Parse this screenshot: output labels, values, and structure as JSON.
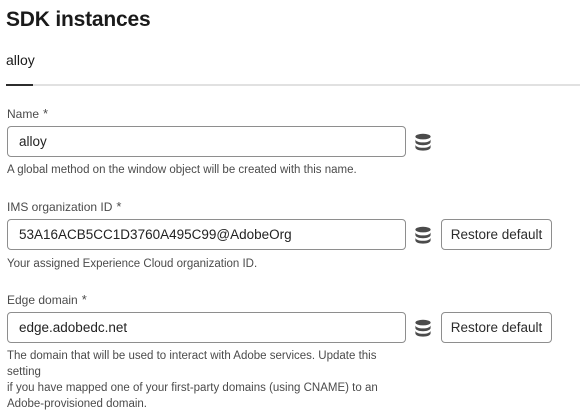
{
  "page": {
    "title": "SDK instances"
  },
  "tabs": [
    {
      "label": "alloy",
      "active": true
    }
  ],
  "fields": {
    "name": {
      "label": "Name",
      "required_marker": "*",
      "value": "alloy",
      "help": "A global method on the window object will be created with this name.",
      "icon": "database-icon"
    },
    "ims_org_id": {
      "label": "IMS organization ID",
      "required_marker": "*",
      "value": "53A16ACB5CC1D3760A495C99@AdobeOrg",
      "help": "Your assigned Experience Cloud organization ID.",
      "icon": "database-icon",
      "restore_label": "Restore default"
    },
    "edge_domain": {
      "label": "Edge domain",
      "required_marker": "*",
      "value": "edge.adobedc.net",
      "help_lines": [
        "The domain that will be used to interact with Adobe services. Update this setting",
        "if you have mapped one of your first-party domains (using CNAME) to an",
        "Adobe-provisioned domain."
      ],
      "icon": "database-icon",
      "restore_label": "Restore default"
    }
  },
  "colors": {
    "border": "#8e8e8e",
    "tab_indicator": "#2c2c2c",
    "divider": "#e1e1e1",
    "icon": "#4b4b4b"
  }
}
